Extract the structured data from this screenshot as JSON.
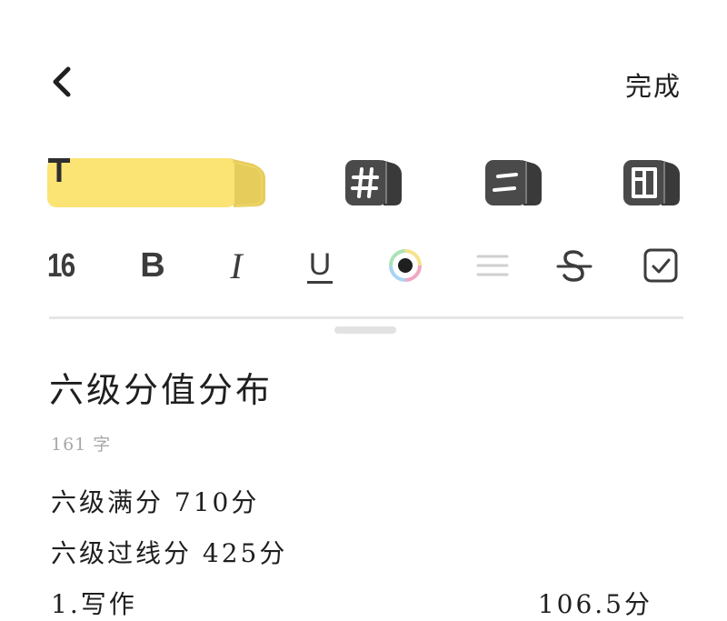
{
  "header": {
    "back_icon": "chevron-left-icon",
    "done_label": "完成"
  },
  "modes": [
    {
      "name": "text",
      "glyph": "T",
      "icon": "text-style-icon",
      "active": true,
      "accent": "#fbe374"
    },
    {
      "name": "heading",
      "icon": "hash-heading-icon",
      "active": false
    },
    {
      "name": "list",
      "icon": "list-icon",
      "active": false
    },
    {
      "name": "layout",
      "icon": "layout-panel-icon",
      "active": false
    }
  ],
  "format": {
    "font_size": "16",
    "bold_label": "B",
    "italic_label": "I",
    "underline_label": "U",
    "color_icon": "color-picker-icon",
    "align_icon": "align-lines-icon",
    "strike_icon": "strikethrough-icon",
    "checkbox_icon": "checkbox-icon"
  },
  "note": {
    "title": "六级分值分布",
    "char_count": "161 字",
    "lines": [
      {
        "text": "六级满分 710分"
      },
      {
        "text": "六级过线分 425分"
      },
      {
        "left": "1.写作",
        "right": "106.5分"
      }
    ]
  }
}
